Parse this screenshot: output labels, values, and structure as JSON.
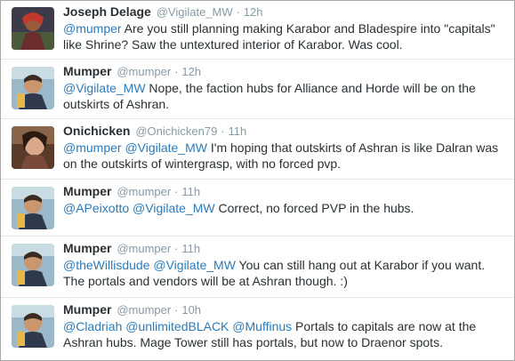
{
  "tweets": [
    {
      "name": "Joseph Delage",
      "handle": "@Vigilate_MW",
      "sep": "·",
      "time": "12h",
      "mentions": [
        "@mumper"
      ],
      "line1": " Are you still planning making Karabor and Bladespire into \"capitals\"",
      "line2": "like Shrine? Saw the untextured interior of Karabor. Was cool."
    },
    {
      "name": "Mumper",
      "handle": "@mumper",
      "sep": "·",
      "time": "12h",
      "mentions": [
        "@Vigilate_MW"
      ],
      "line1": " Nope, the faction hubs for Alliance and Horde will be on the",
      "line2": "outskirts of Ashran."
    },
    {
      "name": "Onichicken",
      "handle": "@Onichicken79",
      "sep": "·",
      "time": "11h",
      "mentions": [
        "@mumper",
        "@Vigilate_MW"
      ],
      "line1": " I'm hoping that outskirts of Ashran is like Dalran was",
      "line2": "on the  outskirts of wintergrasp, with no forced pvp."
    },
    {
      "name": "Mumper",
      "handle": "@mumper",
      "sep": "·",
      "time": "11h",
      "mentions": [
        "@APeixotto",
        "@Vigilate_MW"
      ],
      "line1": " Correct, no forced PVP in the hubs.",
      "line2": ""
    },
    {
      "name": "Mumper",
      "handle": "@mumper",
      "sep": "·",
      "time": "11h",
      "mentions": [
        "@theWillisdude",
        "@Vigilate_MW"
      ],
      "line1": " You can still hang out at Karabor if you want.",
      "line2": "The portals and vendors will be at Ashran though. :)"
    },
    {
      "name": "Mumper",
      "handle": "@mumper",
      "sep": "·",
      "time": "10h",
      "mentions": [
        "@Cladriah",
        "@unlimitedBLACK",
        "@Muffinus"
      ],
      "line1": " Portals to capitals are now at the",
      "line2": "Ashran hubs. Mage Tower still has portals, but now to  Draenor spots."
    }
  ]
}
